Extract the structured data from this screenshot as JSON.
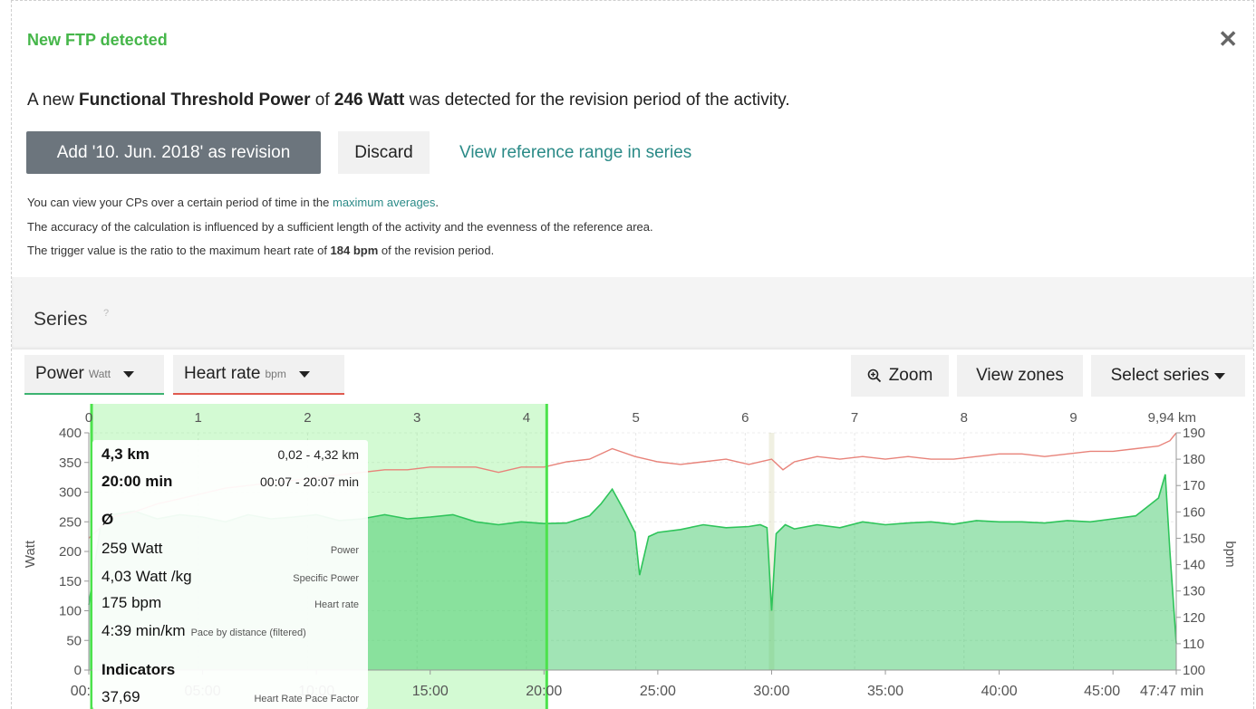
{
  "ftp": {
    "title": "New FTP detected",
    "close_symbol": "✕",
    "msg_prefix": "A new ",
    "msg_term": "Functional Threshold Power",
    "msg_of": " of ",
    "msg_value": "246 Watt",
    "msg_suffix": " was detected for the revision period of the activity.",
    "btn_add": "Add '10. Jun. 2018' as revision",
    "btn_discard": "Discard",
    "link_ref": "View reference range in series",
    "note1_prefix": "You can view your CPs over a certain period of time in the ",
    "note1_link": "maximum averages",
    "note1_suffix": ".",
    "note2": "The accuracy of the calculation is influenced by a sufficient length of the activity and the evenness of the reference area.",
    "note3_prefix": "The trigger value is the ratio to the maximum heart rate of ",
    "note3_value": "184 bpm",
    "note3_suffix": " of the revision period."
  },
  "series": {
    "title": "Series",
    "help": "?",
    "power_label": "Power",
    "power_unit": "Watt",
    "hr_label": "Heart rate",
    "hr_unit": "bpm",
    "zoom_label": "Zoom",
    "view_zones_label": "View zones",
    "select_series_label": "Select series",
    "colors": {
      "power": "#2ec45a",
      "hr": "#e8837a",
      "selection": "#4ce24c",
      "underline_power": "#3cb371",
      "underline_hr": "#e05a4f"
    }
  },
  "tooltip": {
    "distance": "4,3 km",
    "distance_range": "0,02 - 4,32 km",
    "duration": "20:00 min",
    "duration_range": "00:07 - 20:07 min",
    "avg_symbol": "Ø",
    "power": "259 Watt",
    "power_label": "Power",
    "specific_power": "4,03 Watt /kg",
    "specific_power_label": "Specific Power",
    "hr": "175 bpm",
    "hr_label": "Heart rate",
    "pace": "4:39 min/km",
    "pace_label": "Pace by distance (filtered)",
    "indicators": "Indicators",
    "hr_pace_factor": "37,69",
    "hr_pace_factor_label": "Heart Rate Pace Factor"
  },
  "chart_data": {
    "type": "area",
    "left_axis_label": "Watt",
    "right_axis_label": "bpm",
    "top_axis_ticks": [
      "0",
      "1",
      "2",
      "3",
      "4",
      "5",
      "6",
      "7",
      "8",
      "9",
      "9,94 km"
    ],
    "top_axis_values": [
      0,
      1,
      2,
      3,
      4,
      5,
      6,
      7,
      8,
      9,
      9.94
    ],
    "bottom_axis_ticks": [
      "00:",
      "05:00",
      "10:00",
      "15:00",
      "20:00",
      "25:00",
      "30:00",
      "35:00",
      "40:00",
      "45:00",
      "47:47 min"
    ],
    "bottom_axis_values": [
      0,
      5,
      10,
      15,
      20,
      25,
      30,
      35,
      40,
      45,
      47.78
    ],
    "left_ticks": [
      0,
      50,
      100,
      150,
      200,
      250,
      300,
      350,
      400
    ],
    "right_ticks": [
      100,
      110,
      120,
      130,
      140,
      150,
      160,
      170,
      180,
      190
    ],
    "ylim_left": [
      0,
      400
    ],
    "ylim_right": [
      100,
      190
    ],
    "xlim_min": [
      0,
      47.78
    ],
    "selection_min": [
      0.12,
      20.12
    ],
    "series": [
      {
        "name": "Power",
        "unit": "Watt",
        "x_min": [
          0,
          0.5,
          1,
          2,
          3,
          4,
          5,
          6,
          7,
          8,
          9,
          10,
          11,
          12,
          13,
          14,
          15,
          16,
          17,
          18,
          19,
          20,
          21,
          22,
          22.5,
          23,
          23.5,
          24,
          24.2,
          24.6,
          25,
          26,
          27,
          28,
          29,
          29.5,
          29.8,
          30,
          30.2,
          30.6,
          31,
          32,
          33,
          34,
          35,
          36,
          37,
          38,
          39,
          40,
          41,
          42,
          43,
          44,
          45,
          46,
          46.5,
          47,
          47.3,
          47.5,
          47.78
        ],
        "values": [
          110,
          240,
          262,
          268,
          255,
          262,
          258,
          250,
          262,
          255,
          258,
          262,
          252,
          255,
          262,
          255,
          258,
          262,
          250,
          245,
          250,
          247,
          248,
          260,
          280,
          305,
          270,
          232,
          160,
          225,
          232,
          237,
          245,
          240,
          242,
          245,
          240,
          100,
          230,
          245,
          238,
          245,
          240,
          250,
          245,
          248,
          250,
          246,
          252,
          250,
          250,
          248,
          252,
          250,
          255,
          260,
          275,
          290,
          330,
          200,
          45
        ]
      },
      {
        "name": "Heart rate",
        "unit": "bpm",
        "x_min": [
          0,
          1,
          2,
          3,
          4,
          5,
          6,
          7,
          8,
          9,
          10,
          11,
          12,
          13,
          14,
          15,
          16,
          17,
          18,
          19,
          20,
          21,
          22,
          23,
          24,
          25,
          26,
          27,
          28,
          29,
          30,
          30.5,
          31,
          32,
          33,
          34,
          35,
          36,
          37,
          38,
          39,
          40,
          41,
          42,
          43,
          44,
          45,
          46,
          47,
          47.5,
          47.78
        ],
        "values": [
          150,
          158,
          160,
          163,
          165,
          167,
          169,
          170,
          171,
          172,
          173,
          174,
          175,
          176,
          176,
          177,
          177,
          177,
          175,
          177,
          177,
          179,
          180,
          184,
          181,
          179,
          178,
          179,
          180,
          178,
          180,
          176,
          179,
          181,
          180,
          181,
          180,
          181,
          180,
          180,
          181,
          182,
          182,
          181,
          182,
          183,
          183,
          184,
          185,
          187,
          190
        ]
      }
    ]
  }
}
